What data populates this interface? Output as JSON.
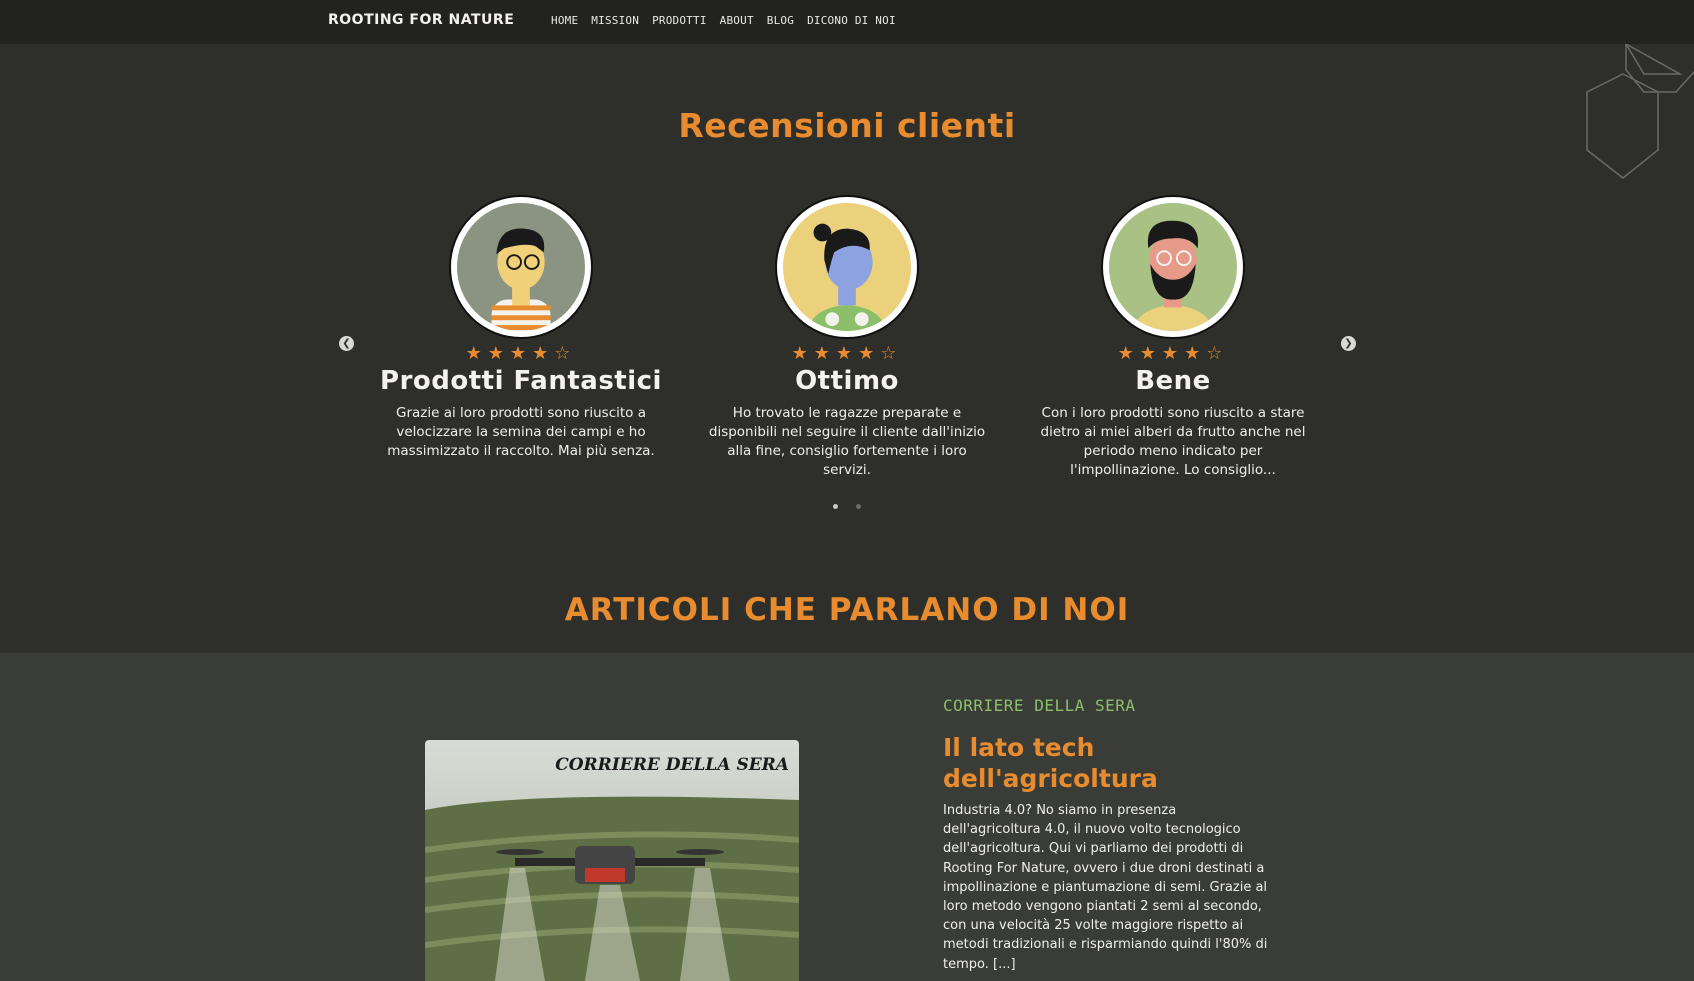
{
  "nav": {
    "brand": "ROOTING FOR NATURE",
    "links": [
      "HOME",
      "MISSION",
      "PRODOTTI",
      "ABOUT",
      "BLOG",
      "DICONO DI NOI"
    ]
  },
  "reviews": {
    "title": "Recensioni clienti",
    "items": [
      {
        "rating": 4,
        "stars": "★★★★☆",
        "title": "Prodotti Fantastici",
        "text": "Grazie ai loro prodotti sono riuscito a velocizzare la semina dei campi e ho massimizzato il raccolto. Mai più senza."
      },
      {
        "rating": 4,
        "stars": "★★★★☆",
        "title": "Ottimo",
        "text": "Ho trovato le ragazze preparate e disponibili nel seguire il cliente dall'inizio alla fine, consiglio fortemente i loro servizi."
      },
      {
        "rating": 4,
        "stars": "★★★★☆",
        "title": "Bene",
        "text": "Con i loro prodotti sono riuscito a stare dietro ai miei alberi da frutto anche nel periodo meno indicato per l'impollinazione. Lo consiglio..."
      }
    ],
    "prev_icon": "chevron-left-icon",
    "next_icon": "chevron-right-icon"
  },
  "articles": {
    "title": "ARTICOLI CHE PARLANO DI NOI",
    "items": [
      {
        "source": "CORRIERE DELLA SERA",
        "image_caption": "CORRIERE DELLA SERA",
        "heading": "Il lato tech dell'agricoltura",
        "body": "Industria 4.0? No siamo in presenza dell'agricoltura 4.0, il nuovo volto tecnologico dell'agricoltura. Qui vi parliamo dei prodotti di Rooting For Nature, ovvero i due droni destinati a impollinazione e piantumazione di semi. Grazie al loro metodo vengono piantati 2 semi al secondo, con una velocità 25 volte maggiore rispetto ai metodi tradizionali e risparmiando quindi l'80% di tempo. [...]"
      }
    ]
  },
  "colors": {
    "background": "#2e2f2b",
    "navbar": "#222321",
    "accent": "#e88c2f",
    "source_green": "#8bbf6a",
    "article_bg": "#3a3c37"
  }
}
